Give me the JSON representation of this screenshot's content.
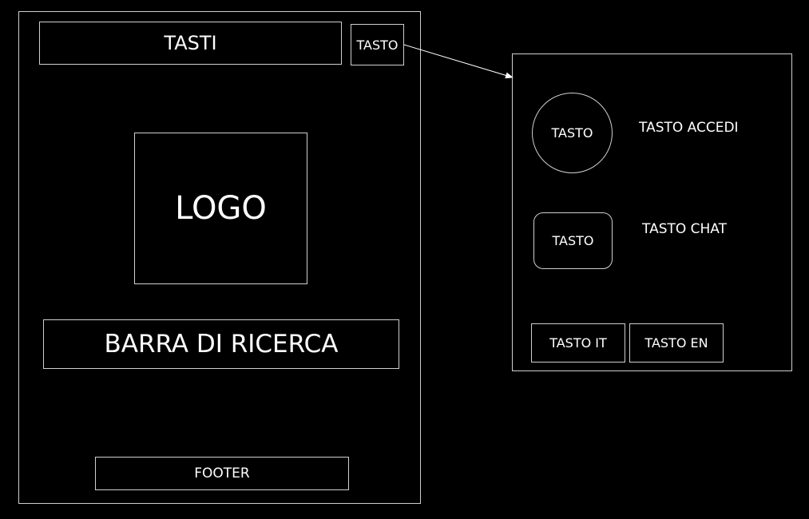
{
  "wireframe_main": {
    "tasti_label": "TASTI",
    "tasto_label": "TASTO",
    "logo_label": "LOGO",
    "search_label": "BARRA DI RICERCA",
    "footer_label": "FOOTER"
  },
  "menu_panel": {
    "circle_button_label": "TASTO",
    "accedi_label": "TASTO ACCEDI",
    "rounded_button_label": "TASTO",
    "chat_label": "TASTO CHAT",
    "it_button_label": "TASTO IT",
    "en_button_label": "TASTO EN"
  },
  "colors": {
    "background": "#000000",
    "stroke": "#cfcfcf",
    "text": "#ffffff"
  }
}
